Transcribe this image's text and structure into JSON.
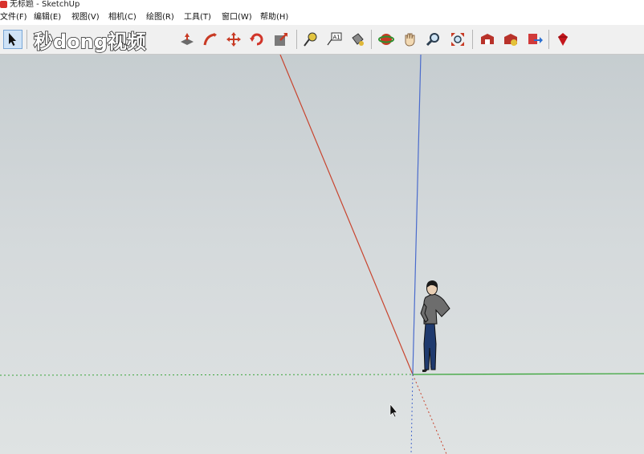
{
  "window": {
    "title": "无标题 - SketchUp"
  },
  "menu": [
    "文件(F)",
    "编辑(E)",
    "视图(V)",
    "相机(C)",
    "绘图(R)",
    "工具(T)",
    "窗口(W)",
    "帮助(H)"
  ],
  "watermark": {
    "text": "秒dong视频"
  },
  "toolbar": {
    "tools": [
      "select-tool",
      "push-pull-tool",
      "follow-me-tool",
      "move-tool",
      "rotate-tool",
      "scale-tool",
      "tape-measure-tool",
      "text-tool",
      "paint-bucket-tool",
      "orbit-tool",
      "pan-tool",
      "zoom-tool",
      "zoom-extents-tool",
      "warehouse-tool",
      "share-model-tool",
      "send-to-layout-tool",
      "ruby-tool"
    ]
  },
  "colors": {
    "red_axis": "#c8442e",
    "green_axis": "#3aa53a",
    "blue_axis": "#4a6bcc"
  }
}
